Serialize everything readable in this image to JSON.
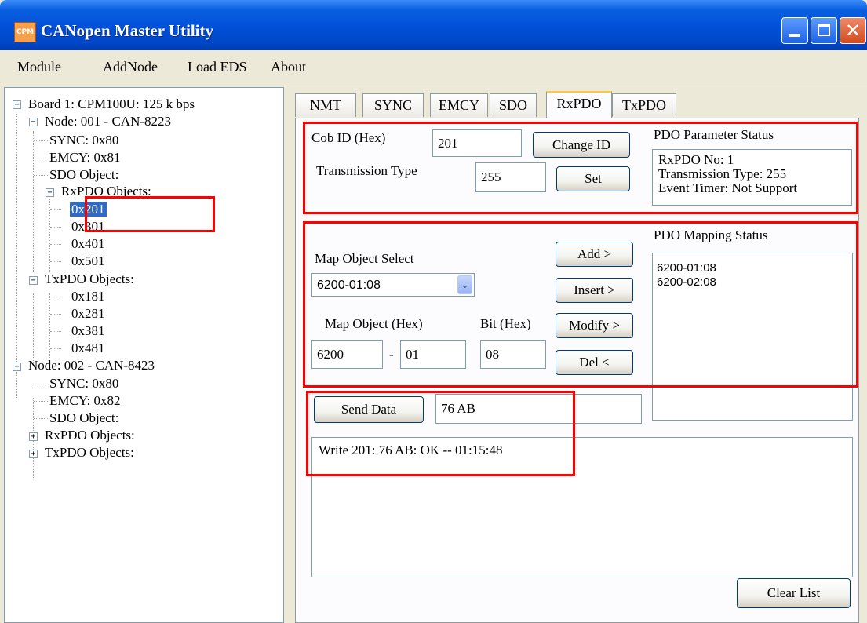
{
  "app": {
    "title": "CANopen Master Utility",
    "icon_text": "CPM"
  },
  "menu": {
    "items": [
      "Module",
      "AddNode",
      "Load EDS",
      "About"
    ]
  },
  "tree": {
    "board": "Board 1: CPM100U:   125 k bps",
    "node1": {
      "label": "Node: 001 - CAN-8223",
      "sync": "SYNC: 0x80",
      "emcy": "EMCY: 0x81",
      "sdo": "SDO Object:",
      "rxpdo": "RxPDO Objects:",
      "rx_items": [
        "0x201",
        "0x301",
        "0x401",
        "0x501"
      ],
      "txpdo": "TxPDO Objects:",
      "tx_items": [
        "0x181",
        "0x281",
        "0x381",
        "0x481"
      ]
    },
    "node2": {
      "label": "Node: 002 - CAN-8423",
      "sync": "SYNC: 0x80",
      "emcy": "EMCY: 0x82",
      "sdo": "SDO Object:",
      "rxpdo": "RxPDO Objects:",
      "txpdo": "TxPDO Objects:"
    },
    "selected": "0x201"
  },
  "tabs": [
    "NMT",
    "SYNC",
    "EMCY",
    "SDO",
    "RxPDO",
    "TxPDO"
  ],
  "active_tab": "RxPDO",
  "pdo_config": {
    "cob_id_label": "Cob ID (Hex)",
    "cob_id_value": "201",
    "change_id_button": "Change ID",
    "transmission_type_label": "Transmission Type",
    "transmission_type_value": "255",
    "set_button": "Set"
  },
  "pdo_parameter_status": {
    "title": "PDO Parameter Status",
    "lines": [
      "RxPDO No: 1",
      "Transmission Type: 255",
      "Event Timer: Not Support"
    ]
  },
  "mapping": {
    "map_object_select_label": "Map Object  Select",
    "map_object_selected": "6200-01:08",
    "map_object_hex_label": "Map Object (Hex)",
    "bit_hex_label": "Bit (Hex)",
    "index_value": "6200",
    "separator": "-",
    "subindex_value": "01",
    "bit_value": "08",
    "add_button": "Add    >",
    "insert_button": "Insert  >",
    "modify_button": "Modify >",
    "del_button": "Del    <"
  },
  "pdo_mapping_status": {
    "title": "PDO Mapping Status",
    "items": [
      "6200-01:08",
      "6200-02:08"
    ]
  },
  "send": {
    "button": "Send Data",
    "data_value": "76 AB"
  },
  "log": {
    "lines": [
      "Write 201: 76 AB: OK -- 01:15:48"
    ]
  },
  "clear_list_button": "Clear List",
  "colors": {
    "title_bar": "#0050d8",
    "highlight_box": "#ff0000",
    "selection": "#316ac5",
    "window_bg": "#ece9d8"
  }
}
